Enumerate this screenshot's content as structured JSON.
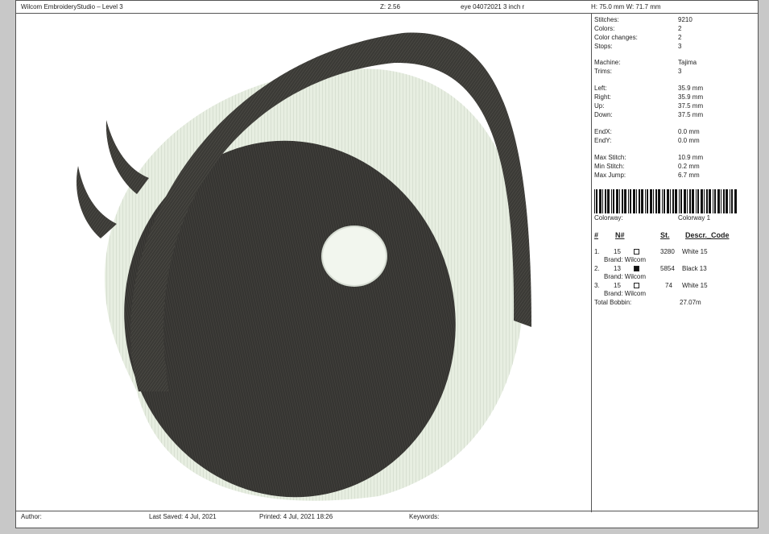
{
  "header": {
    "app_title": "Wilcom EmbroideryStudio – Level 3",
    "zoom": "Z: 2.56",
    "design_name": "eye 04072021 3 inch r",
    "size": "H: 75.0 mm   W: 71.7 mm"
  },
  "stats": [
    {
      "label": "Stitches:",
      "value": "9210"
    },
    {
      "label": "Colors:",
      "value": "2"
    },
    {
      "label": "Color changes:",
      "value": "2"
    },
    {
      "label": "Stops:",
      "value": "3"
    },
    {
      "label": "Machine:",
      "value": "Tajima"
    },
    {
      "label": "Trims:",
      "value": "3"
    },
    {
      "label": "Left:",
      "value": "35.9 mm"
    },
    {
      "label": "Right:",
      "value": "35.9 mm"
    },
    {
      "label": "Up:",
      "value": "37.5 mm"
    },
    {
      "label": "Down:",
      "value": "37.5 mm"
    },
    {
      "label": "EndX:",
      "value": "0.0 mm"
    },
    {
      "label": "EndY:",
      "value": "0.0 mm"
    },
    {
      "label": "Max Stitch:",
      "value": "10.9 mm"
    },
    {
      "label": "Min Stitch:",
      "value": "0.2 mm"
    },
    {
      "label": "Max Jump:",
      "value": "6.7 mm"
    }
  ],
  "colorway": {
    "label": "Colorway:",
    "value": "Colorway 1"
  },
  "color_table": {
    "headers": {
      "num": "#",
      "needle": "N#",
      "stitches": "St.",
      "descr": "Descr._Code"
    },
    "rows": [
      {
        "num": "1.",
        "needle": "15",
        "swatch": "#ffffff",
        "stitches": "3280",
        "descr": "White 15",
        "brand": "Brand: Wilcom"
      },
      {
        "num": "2.",
        "needle": "13",
        "swatch": "#111111",
        "stitches": "5854",
        "descr": "Black 13",
        "brand": "Brand: Wilcom"
      },
      {
        "num": "3.",
        "needle": "15",
        "swatch": "#ffffff",
        "stitches": "74",
        "descr": "White 15",
        "brand": "Brand: Wilcom"
      }
    ],
    "total_bobbin": {
      "label": "Total Bobbin:",
      "value": "27.07m"
    }
  },
  "footer": {
    "author": "Author:",
    "last_saved": "Last Saved:  4 Jul, 2021",
    "printed": "Printed:  4 Jul, 2021 18:26",
    "keywords": "Keywords:"
  },
  "colors": {
    "thread_dark": "#3a3a36",
    "thread_light": "#e6ede0",
    "iris": "#353532"
  }
}
